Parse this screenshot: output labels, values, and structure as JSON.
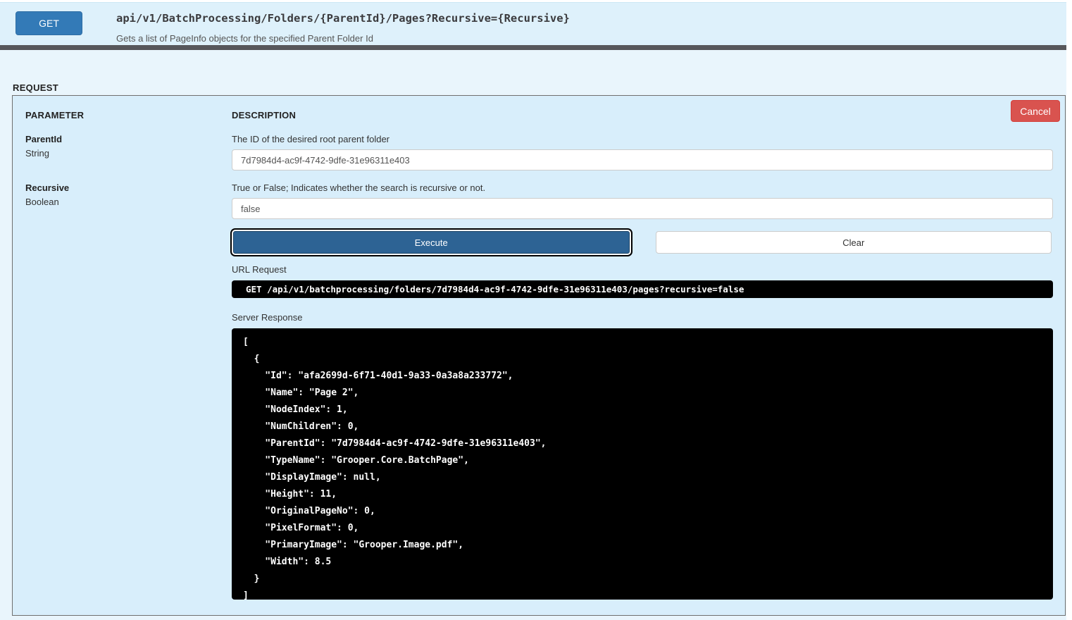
{
  "endpoint": {
    "method": "GET",
    "path": "api/v1/BatchProcessing/Folders/{ParentId}/Pages?Recursive={Recursive}",
    "summary": "Gets a list of PageInfo objects for the specified Parent Folder Id"
  },
  "request": {
    "section_label": "REQUEST",
    "cancel_label": "Cancel",
    "columns": {
      "parameter": "PARAMETER",
      "description": "DESCRIPTION"
    },
    "parameters": [
      {
        "name": "ParentId",
        "type": "String",
        "description": "The ID of the desired root parent folder",
        "value": "7d7984d4-ac9f-4742-9dfe-31e96311e403"
      },
      {
        "name": "Recursive",
        "type": "Boolean",
        "description": "True or False; Indicates whether the search is recursive or not.",
        "value": "false"
      }
    ],
    "execute_label": "Execute",
    "clear_label": "Clear",
    "url_request_label": "URL Request",
    "url_request": "GET /api/v1/batchprocessing/folders/7d7984d4-ac9f-4742-9dfe-31e96311e403/pages?recursive=false",
    "server_response_label": "Server Response",
    "server_response": "[\n  {\n    \"Id\": \"afa2699d-6f71-40d1-9a33-0a3a8a233772\",\n    \"Name\": \"Page 2\",\n    \"NodeIndex\": 1,\n    \"NumChildren\": 0,\n    \"ParentId\": \"7d7984d4-ac9f-4742-9dfe-31e96311e403\",\n    \"TypeName\": \"Grooper.Core.BatchPage\",\n    \"DisplayImage\": null,\n    \"Height\": 11,\n    \"OriginalPageNo\": 0,\n    \"PixelFormat\": 0,\n    \"PrimaryImage\": \"Grooper.Image.pdf\",\n    \"Width\": 8.5\n  }\n]"
  },
  "colors": {
    "page_background": "#e9f5fc",
    "header_background": "#def1fb",
    "divider_bar": "#57575b",
    "method_button": "#337ab7",
    "cancel_button": "#d9534f",
    "execute_button": "#2d6394",
    "console_background": "#000000",
    "console_text": "#ffffff"
  }
}
